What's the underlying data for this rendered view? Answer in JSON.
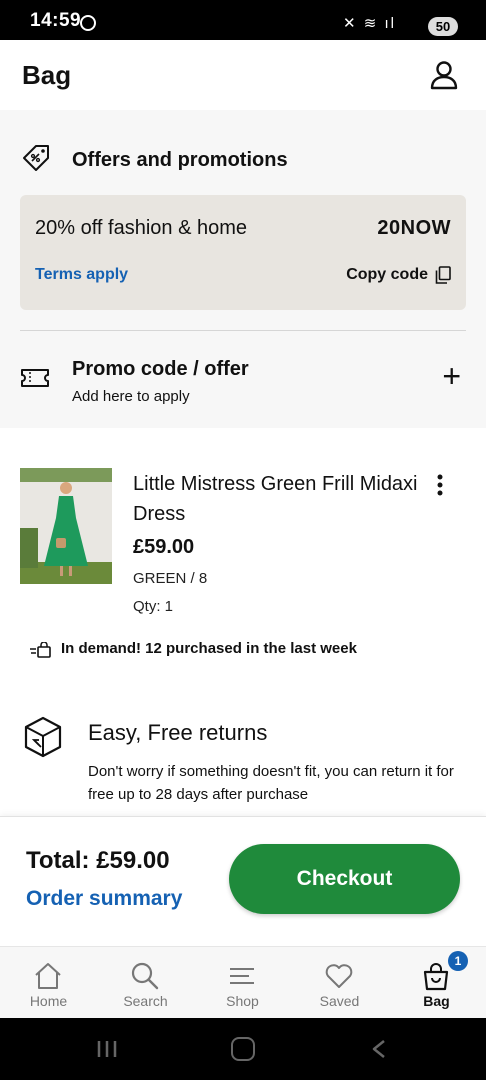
{
  "status_bar": {
    "time": "14:59",
    "icons": "✕ ≋ ıl",
    "battery": "50"
  },
  "header": {
    "title": "Bag",
    "account_icon": "user-icon"
  },
  "offers": {
    "heading": "Offers and promotions",
    "icon": "tag-discount-icon",
    "card": {
      "description": "20% off fashion & home",
      "code": "20NOW",
      "terms_label": "Terms apply",
      "copy_label": "Copy code"
    }
  },
  "promo": {
    "title": "Promo code / offer",
    "subtitle": "Add here to apply",
    "add_symbol": "+"
  },
  "item": {
    "name": "Little Mistress Green Frill Midaxi Dress",
    "price": "£59.00",
    "variant": "GREEN / 8",
    "qty": "Qty: 1",
    "product_color": "#1e9a5c"
  },
  "demand": {
    "text": "In demand! 12 purchased in the last week"
  },
  "returns": {
    "title": "Easy, Free returns",
    "body": "Don't worry if something doesn't fit, you can return it for free up to 28 days after purchase"
  },
  "checkout": {
    "total_label": "Total: £59.00",
    "summary_link": "Order summary",
    "button_label": "Checkout",
    "button_color": "#1f8a3b"
  },
  "nav": {
    "items": [
      {
        "label": "Home",
        "icon": "home-icon"
      },
      {
        "label": "Search",
        "icon": "search-icon"
      },
      {
        "label": "Shop",
        "icon": "menu-icon"
      },
      {
        "label": "Saved",
        "icon": "heart-icon"
      },
      {
        "label": "Bag",
        "icon": "bag-icon"
      }
    ],
    "bag_badge": "1",
    "active": "Bag"
  },
  "colors": {
    "link_blue": "#1561b3",
    "promo_card_bg": "#e8e5e0",
    "page_grey": "#f7f7f7"
  }
}
